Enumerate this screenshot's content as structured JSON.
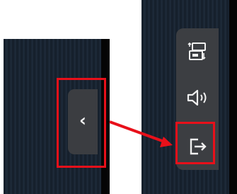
{
  "left_panel": {
    "collapse_tab": {
      "chevron": "‹",
      "icon": "chevron-left-icon"
    }
  },
  "right_panel": {
    "toolbar": {
      "buttons": [
        {
          "name": "screen-switch-button",
          "icon": "screen-switch-icon"
        },
        {
          "name": "sound-button",
          "icon": "speaker-icon"
        },
        {
          "name": "exit-button",
          "icon": "exit-icon"
        }
      ]
    }
  },
  "annotations": {
    "highlight_color": "#e8101a",
    "toolbar_color": "#3c3e42",
    "background_color": "#16202c"
  }
}
